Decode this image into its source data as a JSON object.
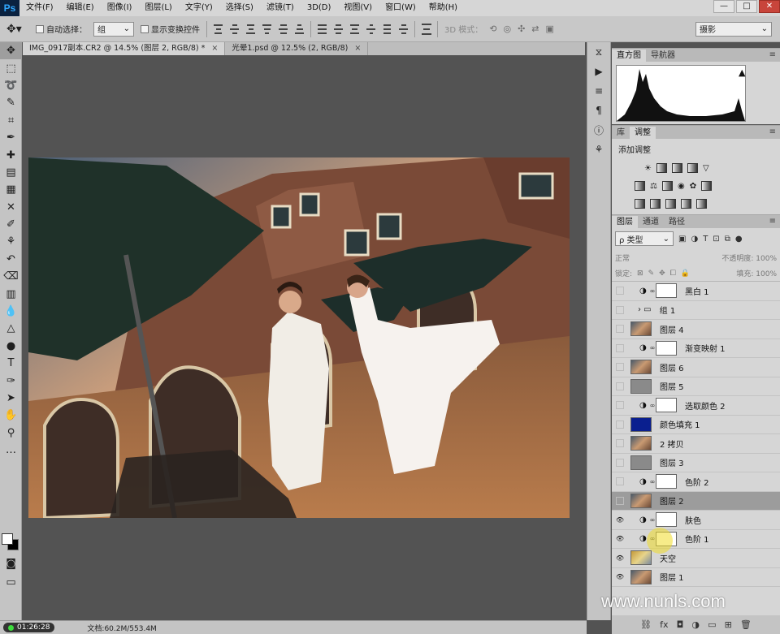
{
  "app": {
    "logo": "Ps"
  },
  "menu": [
    "文件(F)",
    "编辑(E)",
    "图像(I)",
    "图层(L)",
    "文字(Y)",
    "选择(S)",
    "滤镜(T)",
    "3D(D)",
    "视图(V)",
    "窗口(W)",
    "帮助(H)"
  ],
  "window_controls": [
    "—",
    "□",
    "✕"
  ],
  "options": {
    "auto_select_label": "自动选择：",
    "auto_select_value": "组",
    "show_transform_label": "显示变换控件",
    "mode_3d_label": "3D 模式：",
    "workspace": "摄影"
  },
  "tabs": [
    {
      "label": "IMG_0917副本.CR2 @ 14.5% (图层 2, RGB/8) *",
      "close": "×"
    },
    {
      "label": "光晕1.psd @ 12.5% (2, RGB/8)",
      "close": "×"
    }
  ],
  "panels": {
    "histogram_tabs": [
      "直方图",
      "导航器"
    ],
    "adjust_tabs": [
      "库",
      "调整"
    ],
    "adjust_title": "添加调整",
    "layers_tabs": [
      "图层",
      "通道",
      "路径"
    ],
    "kind_filter": "ρ 类型",
    "blend_mode": "正常",
    "opacity_label": "不透明度: 100%",
    "lock_label": "锁定:",
    "fill_label": "填充: 100%"
  },
  "layers": [
    {
      "name": "黑白 1",
      "visible": false,
      "kind": "adjust"
    },
    {
      "name": "组 1",
      "visible": false,
      "kind": "group"
    },
    {
      "name": "图层 4",
      "visible": false,
      "kind": "photo"
    },
    {
      "name": "渐变映射 1",
      "visible": false,
      "kind": "adjust"
    },
    {
      "name": "图层 6",
      "visible": false,
      "kind": "photo"
    },
    {
      "name": "图层 5",
      "visible": false,
      "kind": "gray"
    },
    {
      "name": "选取颜色 2",
      "visible": false,
      "kind": "adjust"
    },
    {
      "name": "颜色填充 1",
      "visible": false,
      "kind": "fill"
    },
    {
      "name": "2 拷贝",
      "visible": false,
      "kind": "photo"
    },
    {
      "name": "图层 3",
      "visible": false,
      "kind": "gray"
    },
    {
      "name": "色阶 2",
      "visible": false,
      "kind": "adjust"
    },
    {
      "name": "图层 2",
      "visible": false,
      "kind": "photo",
      "selected": true
    },
    {
      "name": "肤色",
      "visible": true,
      "kind": "adjust"
    },
    {
      "name": "色阶 1",
      "visible": true,
      "kind": "adjust"
    },
    {
      "name": "天空",
      "visible": true,
      "kind": "sky"
    },
    {
      "name": "图层 1",
      "visible": true,
      "kind": "photo"
    }
  ],
  "status": {
    "recording_time": "01:26:28",
    "doc_size": "文档:60.2M/553.4M"
  },
  "watermark": "www.nunls.com",
  "colors": {
    "accent_blue": "#31a8ff",
    "fill_layer": "#0a1f8f"
  }
}
